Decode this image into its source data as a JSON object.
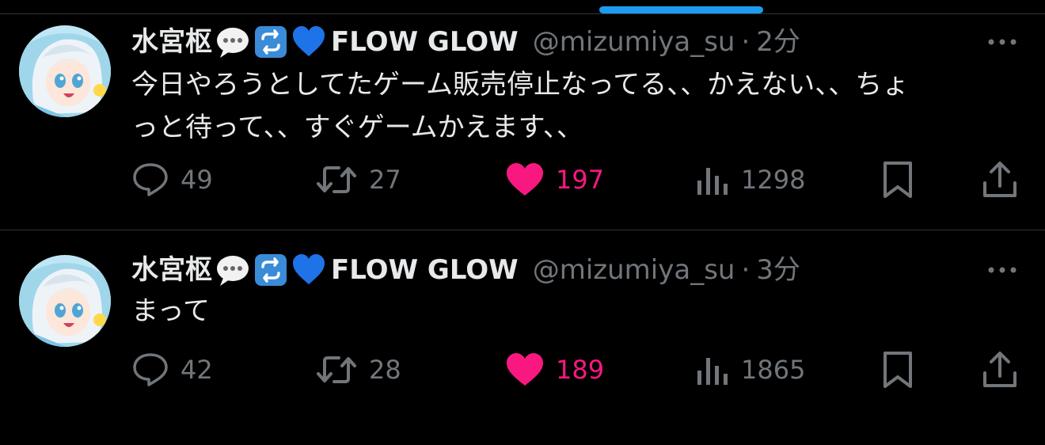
{
  "tweets": [
    {
      "display_name": "水宮枢",
      "brand": "FLOW GLOW",
      "handle": "@mizumiya_su",
      "separator": "·",
      "time": "2分",
      "text_lines": [
        "今日やろうとしてたゲーム販売停止なってる、、かえない、、ちょ",
        "っと待って、、すぐゲームかえます、、"
      ],
      "replies": "49",
      "retweets": "27",
      "likes": "197",
      "views": "1298"
    },
    {
      "display_name": "水宮枢",
      "brand": "FLOW GLOW",
      "handle": "@mizumiya_su",
      "separator": "·",
      "time": "3分",
      "text_lines": [
        "まって"
      ],
      "replies": "42",
      "retweets": "28",
      "likes": "189",
      "views": "1865"
    }
  ],
  "icons": {
    "speech": "speech-bubble-emoji",
    "repeat": "repeat-button-emoji",
    "heart": "blue-heart-emoji",
    "more": "more-icon",
    "reply": "reply-icon",
    "retweet": "retweet-icon",
    "like": "like-heart-icon",
    "views": "views-icon",
    "bookmark": "bookmark-icon",
    "share": "share-icon"
  },
  "colors": {
    "background": "#000000",
    "text": "#e7e9ea",
    "muted": "#71767b",
    "like": "#f91880",
    "accent": "#1d9bf0",
    "divider": "#2f3336"
  }
}
